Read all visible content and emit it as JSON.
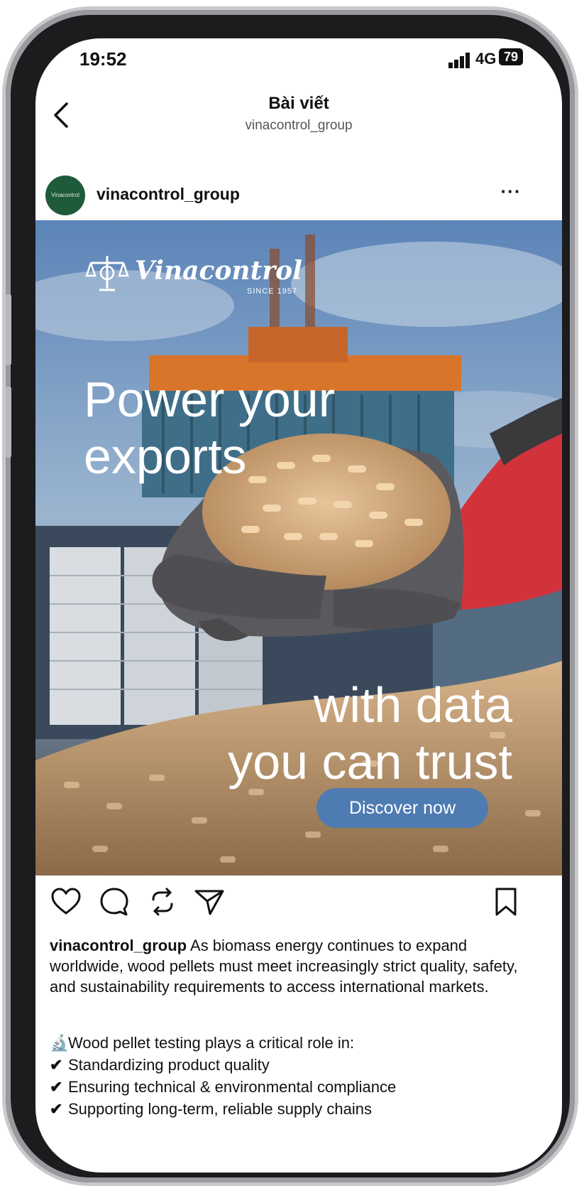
{
  "status_bar": {
    "time": "19:52",
    "network": "4G",
    "battery": "79"
  },
  "header": {
    "title": "Bài viết",
    "subtitle": "vinacontrol_group"
  },
  "post": {
    "username": "vinacontrol_group",
    "avatar_label": "Vinacontrol",
    "more_label": "···",
    "image": {
      "logo": "Vinacontrol",
      "logo_since": "SINCE 1957",
      "headline_top": [
        "Power your",
        "exports"
      ],
      "headline_bottom": [
        "with data",
        "you can trust"
      ],
      "cta": "Discover now",
      "cta_color": "#4e7bb2"
    },
    "actions": [
      "heart-icon",
      "comment-icon",
      "repost-icon",
      "share-icon",
      "bookmark-icon"
    ],
    "caption_user": "vinacontrol_group",
    "caption_text": " As biomass energy continues to expand worldwide, wood pellets must meet increasingly strict quality, safety, and sustainability requirements to access international markets.",
    "bullets": [
      {
        "icon": "microscope-icon",
        "glyph": "🔬",
        "text": "Wood pellet testing plays a critical role in:"
      },
      {
        "icon": "checkmark-icon",
        "glyph": "✔",
        "text": "Standardizing product quality"
      },
      {
        "icon": "checkmark-icon",
        "glyph": "✔",
        "text": "Ensuring technical & environmental compliance"
      },
      {
        "icon": "checkmark-icon",
        "glyph": "✔",
        "text": "Supporting long-term, reliable supply chains"
      }
    ]
  }
}
